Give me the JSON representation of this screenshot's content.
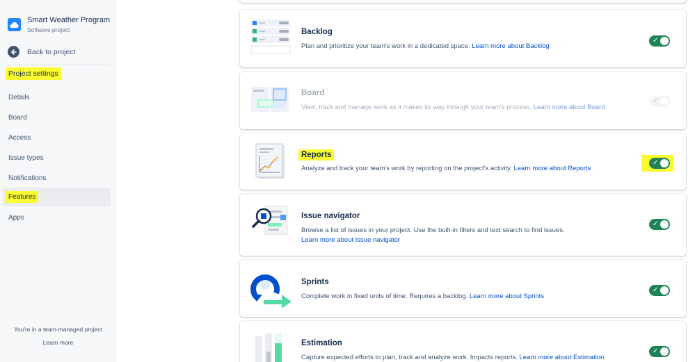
{
  "project": {
    "name": "Smart Weather Program",
    "type": "Software project",
    "avatar_icon": "cloud-icon"
  },
  "sidebar": {
    "back_label": "Back to project",
    "section_title": "Project settings",
    "items": [
      {
        "label": "Details",
        "active": false
      },
      {
        "label": "Board",
        "active": false
      },
      {
        "label": "Access",
        "active": false
      },
      {
        "label": "Issue types",
        "active": false
      },
      {
        "label": "Notifications",
        "active": false
      },
      {
        "label": "Features",
        "active": true
      },
      {
        "label": "Apps",
        "active": false
      }
    ],
    "footer_text": "You're in a team-managed project",
    "footer_link": "Learn more"
  },
  "features": [
    {
      "title": "Backlog",
      "description": "Plan and prioritize your team's work in a dedicated space.",
      "link": "Learn more about Backlog",
      "enabled": true,
      "disabled": false,
      "icon": "backlog-illustration"
    },
    {
      "title": "Board",
      "description": "View, track and manage work as it makes its way through your team's process.",
      "link": "Learn more about Board",
      "enabled": true,
      "disabled": true,
      "icon": "board-illustration"
    },
    {
      "title": "Reports",
      "description": "Analyze and track your team's work by reporting on the project's activity.",
      "link": "Learn more about Reports",
      "enabled": true,
      "disabled": false,
      "icon": "reports-illustration"
    },
    {
      "title": "Issue navigator",
      "description": "Browse a list of issues in your project. Use the built-in filters and text search to find issues.",
      "link": "Learn more about Issue navigator",
      "enabled": true,
      "disabled": false,
      "icon": "issue-navigator-illustration"
    },
    {
      "title": "Sprints",
      "description": "Complete work in fixed units of time. Requires a backlog.",
      "link": "Learn more about Sprints",
      "enabled": true,
      "disabled": false,
      "icon": "sprints-illustration"
    },
    {
      "title": "Estimation",
      "description": "Capture expected efforts to plan, track and analyze work. Impacts reports.",
      "link": "Learn more about Estimation",
      "enabled": true,
      "disabled": false,
      "icon": "estimation-illustration"
    }
  ],
  "colors": {
    "highlight": "#fbfb32",
    "toggle_on": "#1f8455",
    "link": "#0052cc"
  },
  "toggle_check": "✓"
}
